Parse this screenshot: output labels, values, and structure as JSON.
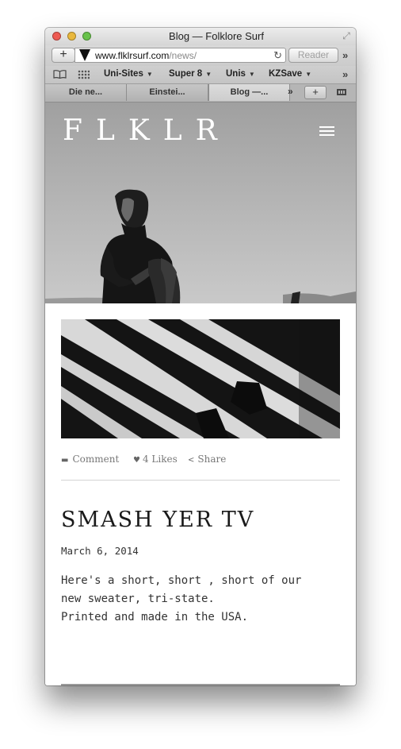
{
  "window": {
    "title": "Blog — Folklore Surf",
    "fullscreen_icon": "fullscreen-icon"
  },
  "toolbar": {
    "add_label": "+",
    "url_host": "www.flklrsurf.com",
    "url_path": "/news/",
    "reader_label": "Reader"
  },
  "bookmarks": {
    "items": [
      {
        "label": "Uni-Sites"
      },
      {
        "label": "Super 8"
      },
      {
        "label": "Unis"
      },
      {
        "label": "KZSave"
      }
    ],
    "more": "»"
  },
  "tabs": {
    "items": [
      {
        "label": "Die ne..."
      },
      {
        "label": "Einstei..."
      },
      {
        "label": "Blog —..."
      }
    ],
    "more": "»",
    "new_tab": "+"
  },
  "site": {
    "logo": "FLKLR",
    "menu_icon": "hamburger-menu-icon"
  },
  "post": {
    "comment_label": "Comment",
    "likes_label": "4 Likes",
    "share_label": "Share",
    "title": "SMASH YER TV",
    "date": "March 6, 2014",
    "body_lines": [
      "Here's a short, short , short of our",
      "new sweater, tri-state.",
      "Printed and made in the USA."
    ]
  },
  "colors": {
    "close": "#ee5a52",
    "minimize": "#e9b83d",
    "zoom": "#68c24b",
    "text_dark": "#1a1a1a"
  }
}
